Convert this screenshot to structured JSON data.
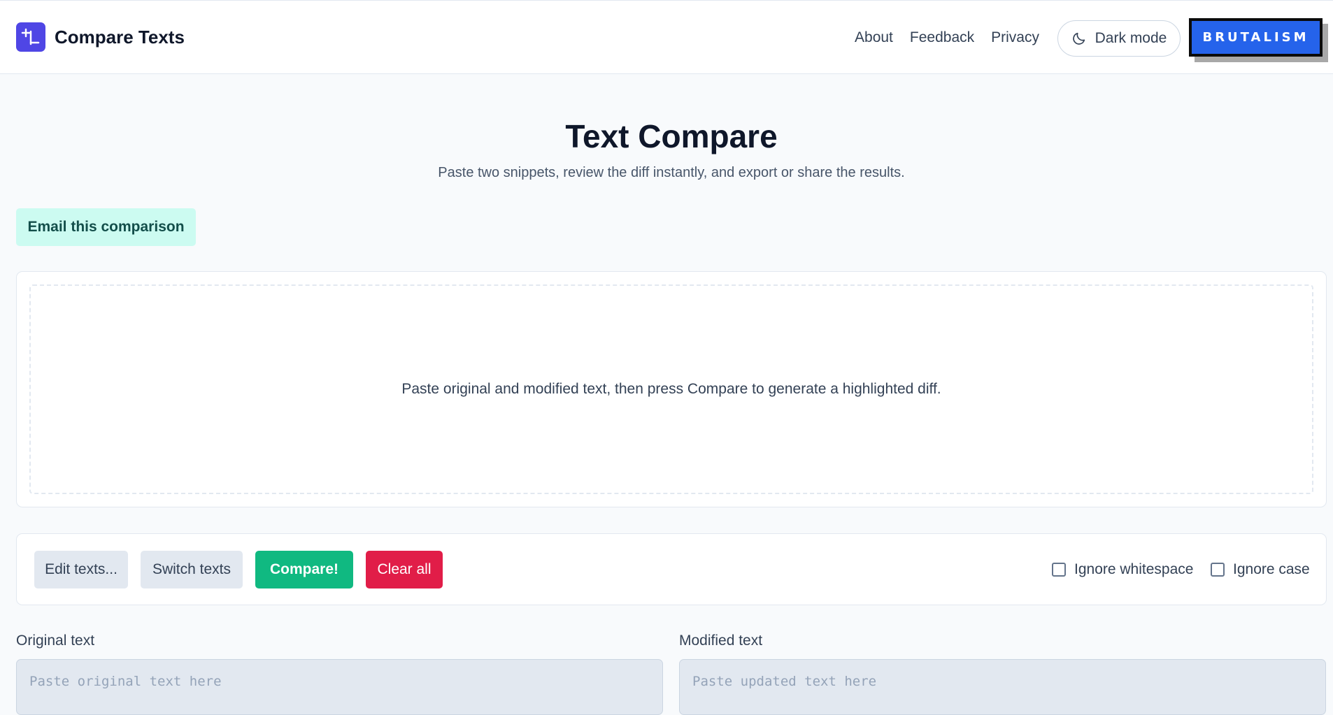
{
  "app": {
    "title": "Compare Texts"
  },
  "header": {
    "nav": [
      {
        "label": "About"
      },
      {
        "label": "Feedback"
      },
      {
        "label": "Privacy"
      }
    ],
    "dark_mode_label": "Dark mode",
    "dark_mode_icon": "moon-icon",
    "brutalism_label": "BRUTALISM"
  },
  "hero": {
    "title": "Text Compare",
    "subtitle": "Paste two snippets, review the diff instantly, and export or share the results."
  },
  "actions": {
    "email_label": "Email this comparison"
  },
  "diff": {
    "empty_message": "Paste original and modified text, then press Compare to generate a highlighted diff."
  },
  "toolbar": {
    "edit_label": "Edit texts...",
    "switch_label": "Switch texts",
    "compare_label": "Compare!",
    "clear_label": "Clear all",
    "ignore_whitespace_label": "Ignore whitespace",
    "ignore_whitespace_checked": false,
    "ignore_case_label": "Ignore case",
    "ignore_case_checked": false
  },
  "inputs": {
    "original": {
      "label": "Original text",
      "placeholder": "Paste original text here",
      "value": ""
    },
    "modified": {
      "label": "Modified text",
      "placeholder": "Paste updated text here",
      "value": ""
    }
  },
  "colors": {
    "brand": "#4f46e5",
    "brutalism": "#2563eb",
    "compare": "#10b981",
    "clear": "#e11d48",
    "email_bg": "#ccfbf1"
  }
}
